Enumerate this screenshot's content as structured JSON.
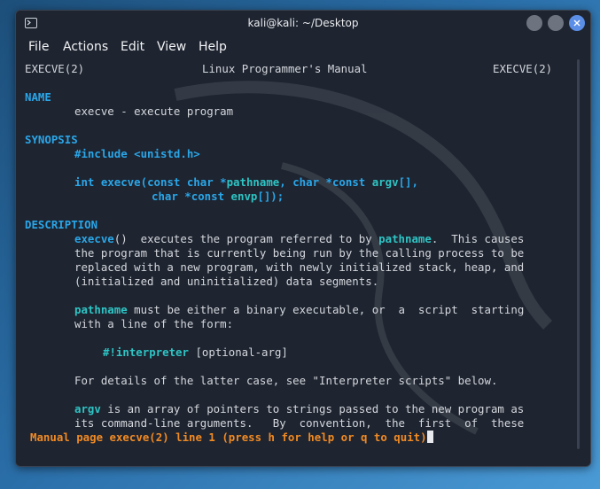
{
  "window": {
    "title": "kali@kali: ~/Desktop",
    "icon": "terminal-icon"
  },
  "menu": {
    "items": [
      "File",
      "Actions",
      "Edit",
      "View",
      "Help"
    ]
  },
  "man": {
    "header_left": "EXECVE(2)",
    "header_center": "Linux Programmer's Manual",
    "header_right": "EXECVE(2)",
    "name_heading": "NAME",
    "name_text": "execve - execute program",
    "synopsis_heading": "SYNOPSIS",
    "include_line": "#include <unistd.h>",
    "proto": {
      "t1": "int ",
      "fn": "execve",
      "t2": "(const char *",
      "a1": "pathname",
      "t3": ", char *const ",
      "a2": "argv",
      "t4": "[],",
      "t5": "char *const ",
      "a3": "envp",
      "t6": "[]);"
    },
    "description_heading": "DESCRIPTION",
    "desc1": {
      "w1": "execve",
      "r1": "()  executes the program referred to by ",
      "w2": "pathname",
      "r2": ".  This causes",
      "l2": "the program that is currently being run by the calling process to be",
      "l3": "replaced with a new program, with newly initialized stack, heap, and",
      "l4": "(initialized and uninitialized) data segments."
    },
    "desc2": {
      "w1": "pathname",
      "r1": " must be either a binary executable, or  a  script  starting",
      "l2": "with a line of the form:"
    },
    "interp": {
      "w1": "#!interpreter",
      "r1": " [optional-arg]"
    },
    "desc3": "For details of the latter case, see \"Interpreter scripts\" below.",
    "desc4": {
      "w1": "argv",
      "r1": " is an array of pointers to strings passed to the new program as",
      "l2": "its command-line arguments.   By  convention,  the  first  of  these"
    },
    "status": "Manual page execve(2) line 1 (press h for help or q to quit)"
  },
  "colors": {
    "section": "#2aa6e8",
    "status": "#f08a24",
    "background": "#1e2430"
  }
}
